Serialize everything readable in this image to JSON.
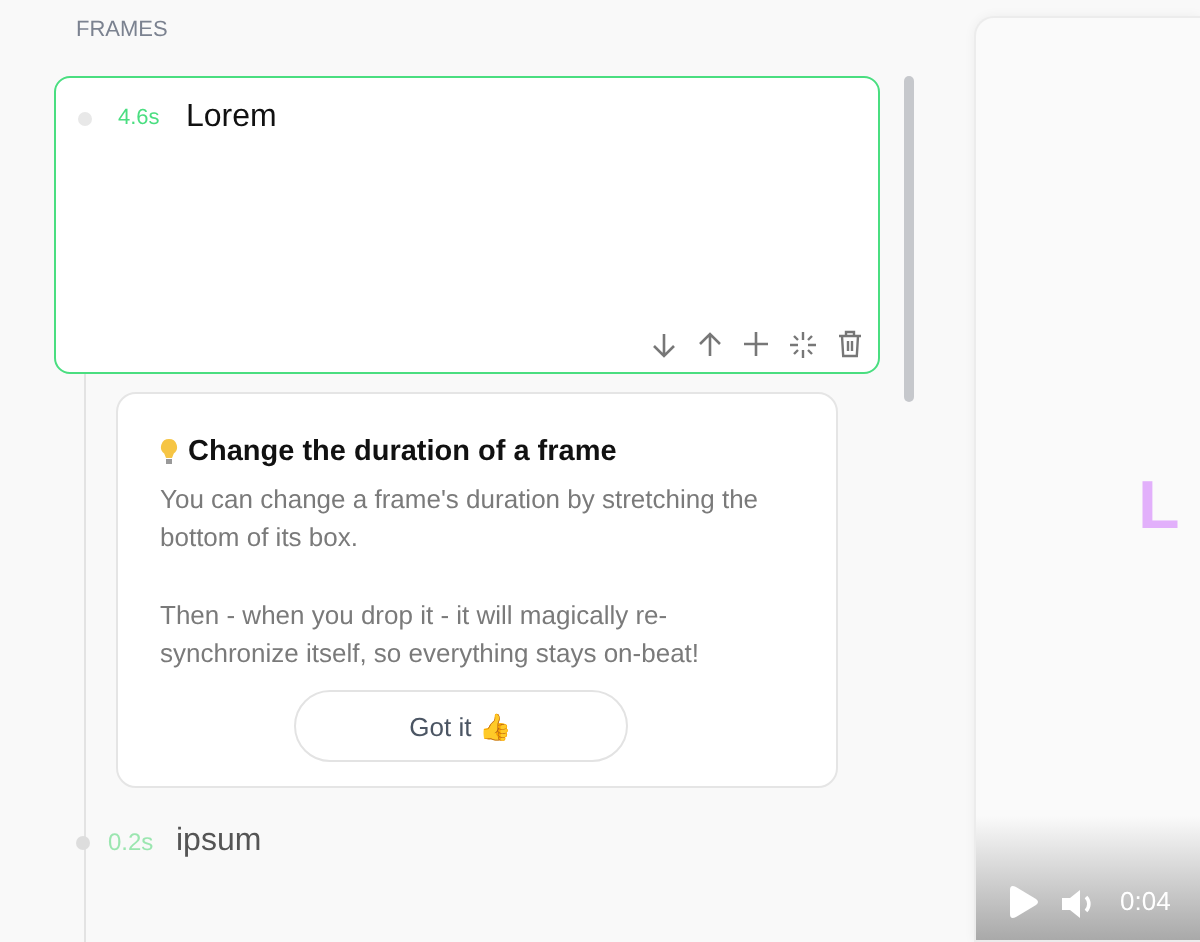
{
  "section_title": "FRAMES",
  "frames": [
    {
      "duration": "4.6s",
      "text": "Lorem",
      "selected": true
    },
    {
      "duration": "0.2s",
      "text": "ipsum",
      "selected": false
    }
  ],
  "tip": {
    "title": "Change the duration of a frame",
    "paragraphs": [
      "You can change a frame's duration by stretching the bottom of its box.",
      "Then - when you drop it - it will magically re-synchronize itself, so everything stays on-beat!"
    ],
    "button": "Got it 👍"
  },
  "preview": {
    "text": "L",
    "time": "0:04"
  }
}
